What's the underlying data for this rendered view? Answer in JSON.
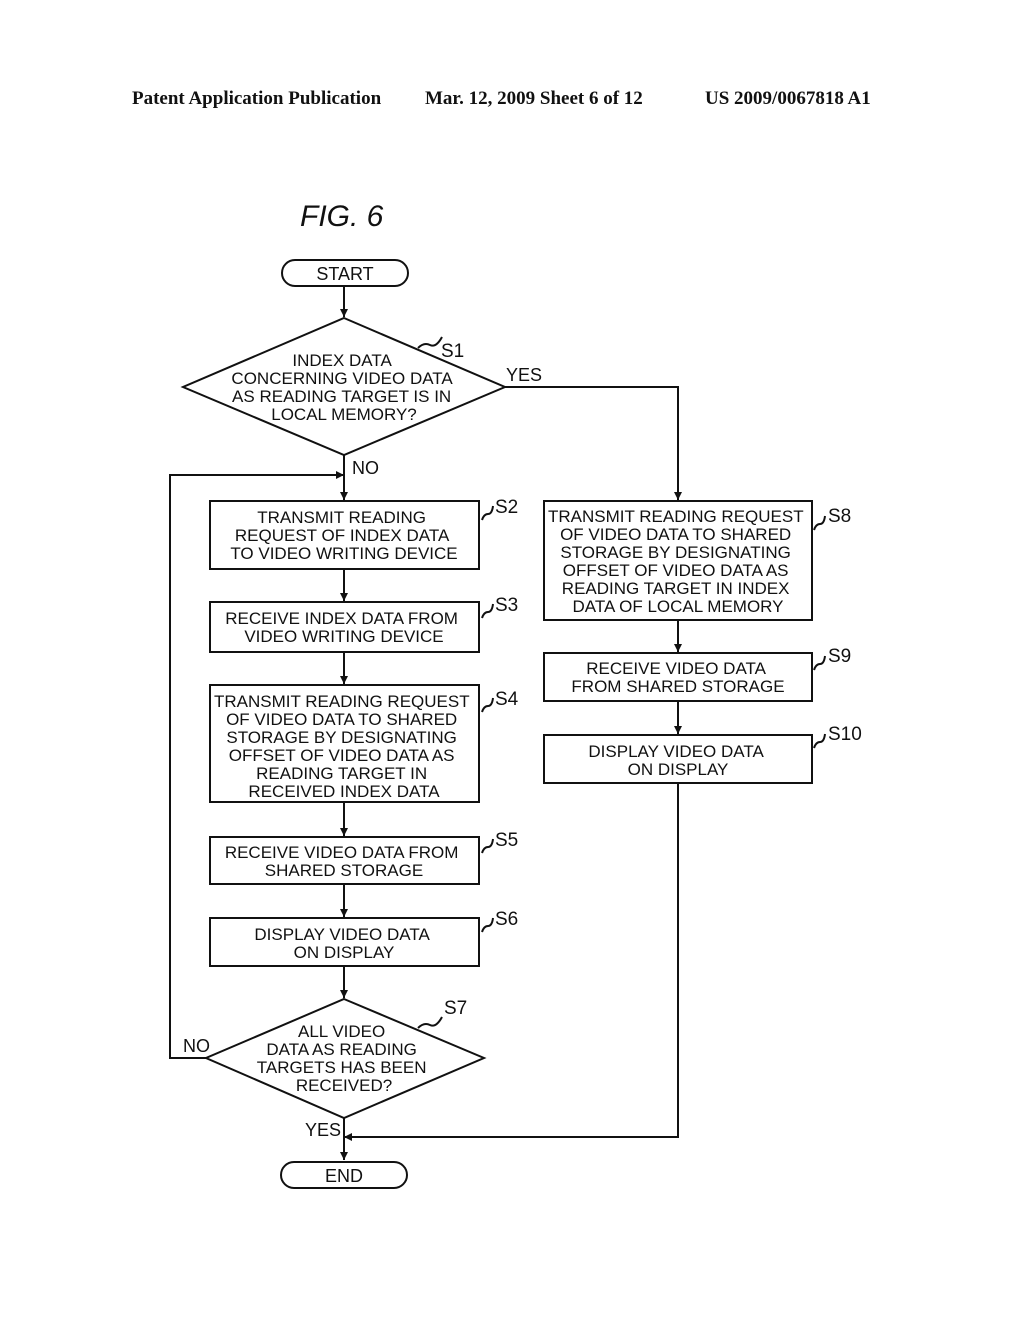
{
  "header": {
    "left": "Patent Application Publication",
    "middle": "Mar. 12, 2009  Sheet 6 of 12",
    "right": "US 2009/0067818 A1"
  },
  "figure_title": "FIG.  6",
  "flowchart": {
    "start": "START",
    "end": "END",
    "steps": {
      "S1": {
        "id": "S1",
        "type": "decision",
        "lines": [
          "INDEX DATA",
          "CONCERNING VIDEO DATA",
          "AS READING TARGET IS IN",
          "LOCAL MEMORY?"
        ],
        "yes_label": "YES",
        "no_label": "NO"
      },
      "S2": {
        "id": "S2",
        "type": "process",
        "lines": [
          "TRANSMIT READING",
          "REQUEST OF INDEX DATA",
          "TO VIDEO WRITING DEVICE"
        ]
      },
      "S3": {
        "id": "S3",
        "type": "process",
        "lines": [
          "RECEIVE INDEX DATA FROM",
          "VIDEO WRITING DEVICE"
        ]
      },
      "S4": {
        "id": "S4",
        "type": "process",
        "lines": [
          "TRANSMIT READING REQUEST",
          "OF VIDEO DATA TO SHARED",
          "STORAGE BY DESIGNATING",
          "OFFSET OF VIDEO DATA AS",
          "READING TARGET IN",
          "RECEIVED INDEX DATA"
        ]
      },
      "S5": {
        "id": "S5",
        "type": "process",
        "lines": [
          "RECEIVE VIDEO DATA FROM",
          "SHARED STORAGE"
        ]
      },
      "S6": {
        "id": "S6",
        "type": "process",
        "lines": [
          "DISPLAY VIDEO DATA",
          "ON DISPLAY"
        ]
      },
      "S7": {
        "id": "S7",
        "type": "decision",
        "lines": [
          "ALL VIDEO",
          "DATA AS READING",
          "TARGETS HAS BEEN",
          "RECEIVED?"
        ],
        "yes_label": "YES",
        "no_label": "NO"
      },
      "S8": {
        "id": "S8",
        "type": "process",
        "lines": [
          "TRANSMIT READING REQUEST",
          "OF VIDEO DATA TO SHARED",
          "STORAGE BY DESIGNATING",
          "OFFSET OF VIDEO DATA AS",
          "READING TARGET IN INDEX",
          "DATA OF LOCAL MEMORY"
        ]
      },
      "S9": {
        "id": "S9",
        "type": "process",
        "lines": [
          "RECEIVE VIDEO DATA",
          "FROM SHARED STORAGE"
        ]
      },
      "S10": {
        "id": "S10",
        "type": "process",
        "lines": [
          "DISPLAY VIDEO DATA",
          "ON DISPLAY"
        ]
      }
    },
    "edges": [
      {
        "from": "START",
        "to": "S1"
      },
      {
        "from": "S1",
        "to": "S8",
        "label": "YES"
      },
      {
        "from": "S1",
        "to": "S2",
        "label": "NO"
      },
      {
        "from": "S2",
        "to": "S3"
      },
      {
        "from": "S3",
        "to": "S4"
      },
      {
        "from": "S4",
        "to": "S5"
      },
      {
        "from": "S5",
        "to": "S6"
      },
      {
        "from": "S6",
        "to": "S7"
      },
      {
        "from": "S7",
        "to": "S2",
        "label": "NO"
      },
      {
        "from": "S7",
        "to": "END",
        "label": "YES"
      },
      {
        "from": "S8",
        "to": "S9"
      },
      {
        "from": "S9",
        "to": "S10"
      },
      {
        "from": "S10",
        "to": "END"
      }
    ]
  }
}
